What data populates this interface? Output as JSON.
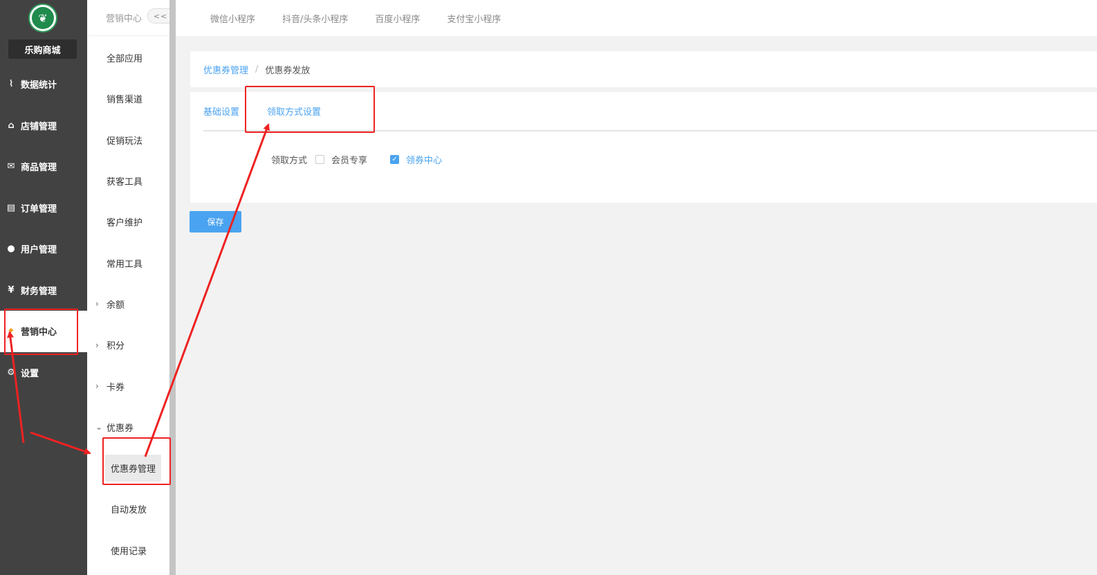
{
  "sidebar": {
    "shop_name": "乐购商城",
    "logo_glyph": "❦",
    "items": [
      {
        "label": "数据统计",
        "icon": "chart-line-icon",
        "glyph": "⌇"
      },
      {
        "label": "店铺管理",
        "icon": "home-icon",
        "glyph": "⌂"
      },
      {
        "label": "商品管理",
        "icon": "bag-icon",
        "glyph": "✉"
      },
      {
        "label": "订单管理",
        "icon": "clipboard-icon",
        "glyph": "▤"
      },
      {
        "label": "用户管理",
        "icon": "user-icon",
        "glyph": "●"
      },
      {
        "label": "财务管理",
        "icon": "wallet-icon",
        "glyph": "¥"
      },
      {
        "label": "营销中心",
        "icon": "marketing-icon",
        "glyph": "✦"
      },
      {
        "label": "设置",
        "icon": "gear-icon",
        "glyph": "⚙"
      }
    ]
  },
  "submenu": {
    "title": "营销中心",
    "collapse_label": "<<",
    "items": [
      {
        "label": "全部应用"
      },
      {
        "label": "销售渠道"
      },
      {
        "label": "促销玩法"
      },
      {
        "label": "获客工具"
      },
      {
        "label": "客户维护"
      },
      {
        "label": "常用工具"
      },
      {
        "label": "余额",
        "chevron": "›"
      },
      {
        "label": "积分",
        "chevron": "›"
      },
      {
        "label": "卡券",
        "chevron": "›"
      },
      {
        "label": "优惠券",
        "chevron": "⌄"
      }
    ],
    "children": [
      {
        "label": "优惠券管理"
      },
      {
        "label": "自动发放"
      },
      {
        "label": "使用记录"
      }
    ]
  },
  "topbar": {
    "tabs": [
      "微信小程序",
      "抖音/头条小程序",
      "百度小程序",
      "支付宝小程序"
    ]
  },
  "breadcrumb": {
    "parent": "优惠券管理",
    "separator": "/",
    "current": "优惠券发放"
  },
  "panel": {
    "tabs": [
      "基础设置",
      "领取方式设置"
    ],
    "field_label": "领取方式",
    "options": [
      {
        "label": "会员专享",
        "checked": false
      },
      {
        "label": "领券中心",
        "checked": true
      }
    ]
  },
  "save_label": "保存",
  "colors": {
    "accent": "#4aa3f0",
    "sidebar_bg": "#424242",
    "annotation_red": "#ee2222"
  }
}
